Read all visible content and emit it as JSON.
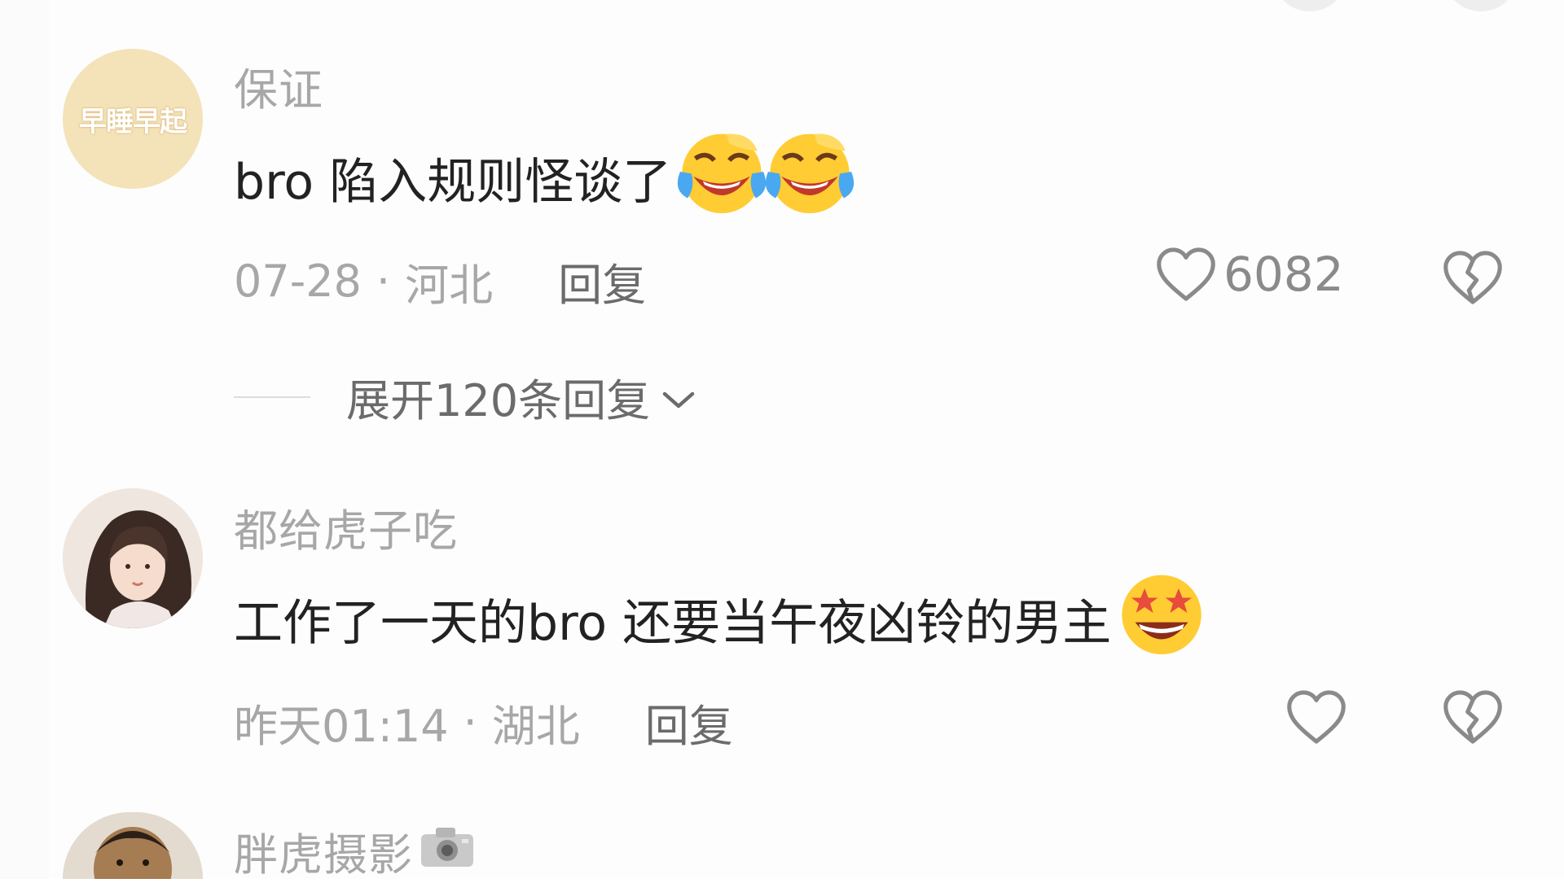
{
  "top_buttons": [
    "",
    ""
  ],
  "comments": [
    {
      "author": "保证",
      "avatar_text": "早睡早起",
      "text": "bro 陷入规则怪谈了",
      "emojis": [
        "laughing-crying",
        "laughing-crying"
      ],
      "date": "07-28",
      "separator": "·",
      "location": "河北",
      "reply_label": "回复",
      "like_count": "6082",
      "expand_label": "展开120条回复"
    },
    {
      "author": "都给虎子吃",
      "text": "工作了一天的bro 还要当午夜凶铃的男主",
      "emojis": [
        "star-struck"
      ],
      "date": "昨天01:14",
      "separator": "·",
      "location": "湖北",
      "reply_label": "回复",
      "like_count": ""
    },
    {
      "author": "胖虎摄影",
      "author_emoji": "camera"
    }
  ],
  "colors": {
    "author": "#a7a7a7",
    "text": "#222222",
    "meta": "#a7a7a7",
    "reply": "#6b6b6b",
    "icon": "#8a8a8a",
    "avatar1_bg": "#f4e2b8"
  }
}
